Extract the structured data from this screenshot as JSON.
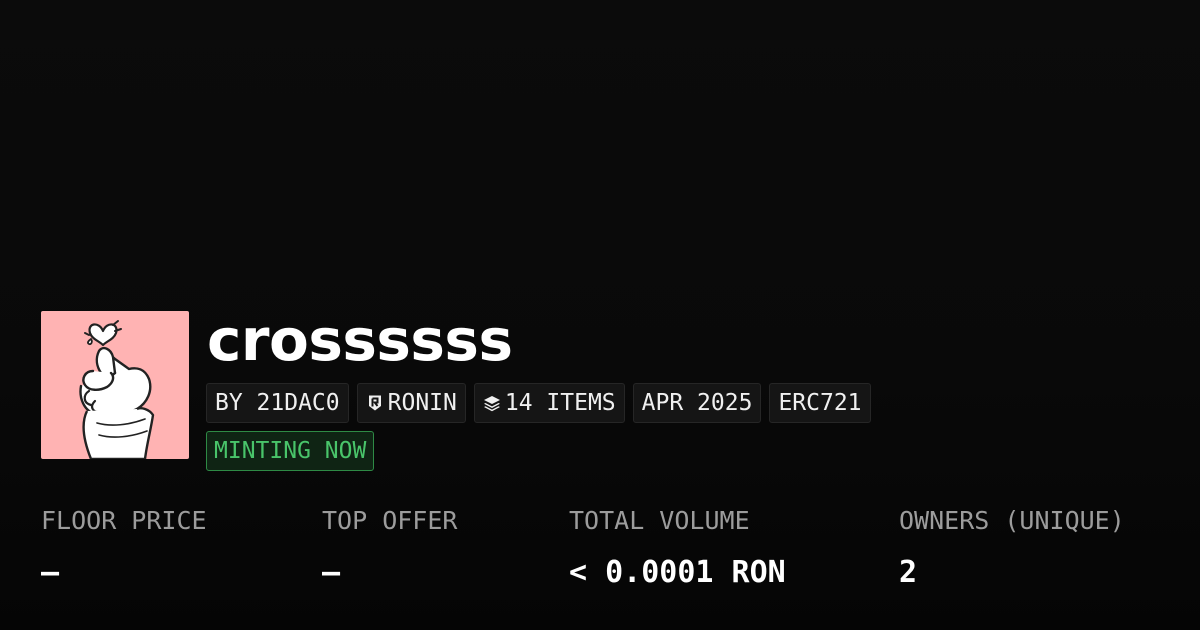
{
  "collection": {
    "name": "crossssss",
    "avatar_icon": "finger-heart-icon",
    "avatar_bg_color": "#ffb3b3"
  },
  "tags": {
    "creator": "BY 21DAC0",
    "chain": "RONIN",
    "chain_icon": "ronin-icon",
    "items": "14 ITEMS",
    "items_icon": "layers-icon",
    "date": "APR 2025",
    "standard": "ERC721"
  },
  "status": {
    "label": "MINTING NOW",
    "color": "#49c46a"
  },
  "stats": {
    "floor_price": {
      "label": "FLOOR PRICE",
      "value": "–"
    },
    "top_offer": {
      "label": "TOP OFFER",
      "value": "–"
    },
    "total_volume": {
      "label": "TOTAL VOLUME",
      "value": "< 0.0001 RON"
    },
    "owners": {
      "label": "OWNERS (UNIQUE)",
      "value": "2"
    }
  }
}
